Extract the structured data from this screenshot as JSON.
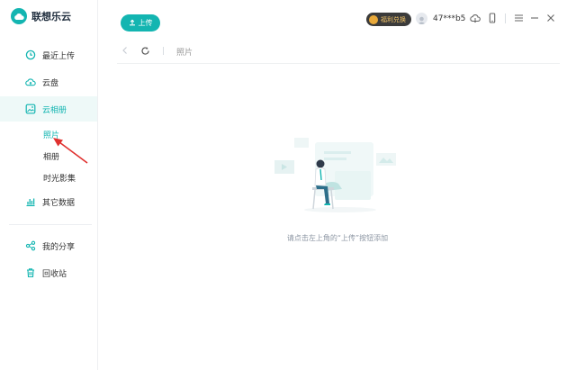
{
  "app": {
    "title": "联想乐云"
  },
  "sidebar": {
    "items": [
      {
        "label": "最近上传"
      },
      {
        "label": "云盘"
      },
      {
        "label": "云相册"
      },
      {
        "label": "其它数据"
      },
      {
        "label": "我的分享"
      },
      {
        "label": "回收站"
      }
    ],
    "album_sub": [
      {
        "label": "照片"
      },
      {
        "label": "相册"
      },
      {
        "label": "时光影集"
      }
    ]
  },
  "header": {
    "upload_label": "上传",
    "vip_badge": "福利兑换",
    "username": "47***b5"
  },
  "toolbar": {
    "breadcrumb": "照片"
  },
  "main": {
    "empty_text": "请点击左上角的“上传”按钮添加"
  },
  "colors": {
    "accent": "#13b5b1",
    "annotation_arrow": "#e0312f"
  }
}
